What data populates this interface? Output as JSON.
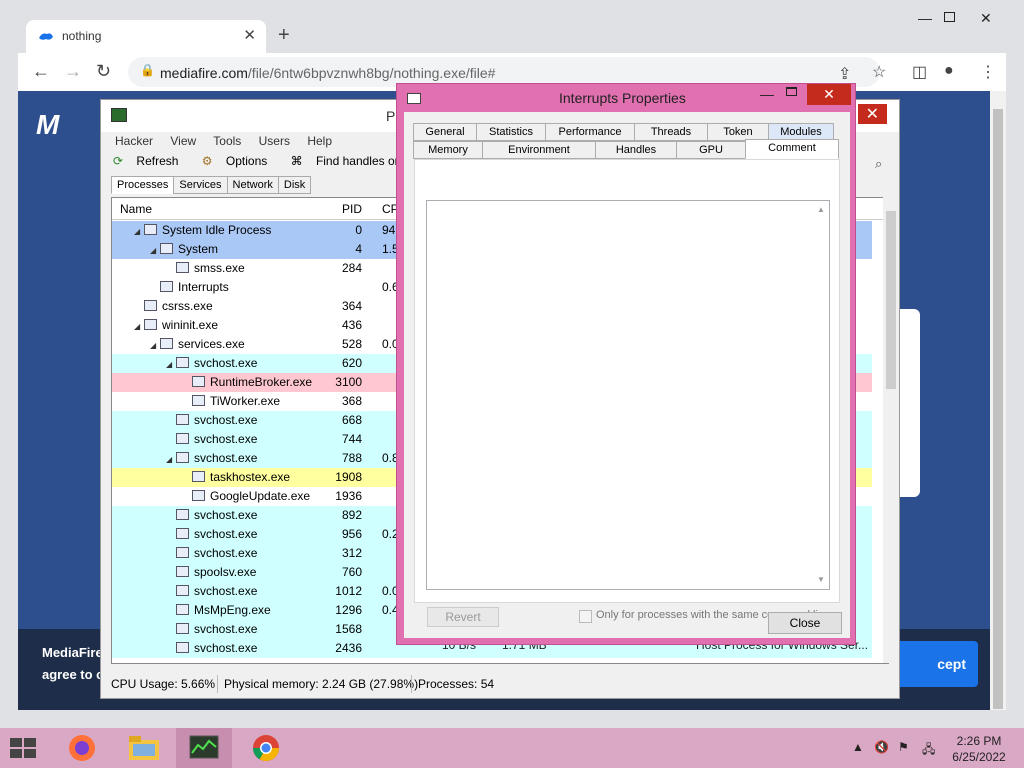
{
  "browser": {
    "tab_title": "nothing",
    "url_domain": "mediafire.com",
    "url_path": "/file/6ntw6bpvznwh8bg/nothing.exe/file#",
    "page": {
      "logo_text": "M",
      "cookie_text1": "MediaFire",
      "cookie_text2": "agree to c",
      "accept_label": "cept"
    }
  },
  "ph": {
    "title": "Pr",
    "menu": [
      "Hacker",
      "View",
      "Tools",
      "Users",
      "Help"
    ],
    "toolbar": {
      "refresh": "Refresh",
      "options": "Options",
      "find": "Find handles or DLLs"
    },
    "tabs": [
      "Processes",
      "Services",
      "Network",
      "Disk"
    ],
    "columns": {
      "name": "Name",
      "pid": "PID",
      "cpu": "CP"
    },
    "processes": [
      {
        "name": "System Idle Process",
        "pid": "0",
        "cpu": "94.3"
      },
      {
        "name": "System",
        "pid": "4",
        "cpu": "1.5"
      },
      {
        "name": "smss.exe",
        "pid": "284",
        "cpu": ""
      },
      {
        "name": "Interrupts",
        "pid": "",
        "cpu": "0.6"
      },
      {
        "name": "csrss.exe",
        "pid": "364",
        "cpu": ""
      },
      {
        "name": "wininit.exe",
        "pid": "436",
        "cpu": ""
      },
      {
        "name": "services.exe",
        "pid": "528",
        "cpu": "0.0"
      },
      {
        "name": "svchost.exe",
        "pid": "620",
        "cpu": ""
      },
      {
        "name": "RuntimeBroker.exe",
        "pid": "3100",
        "cpu": ""
      },
      {
        "name": "TiWorker.exe",
        "pid": "368",
        "cpu": ""
      },
      {
        "name": "svchost.exe",
        "pid": "668",
        "cpu": ""
      },
      {
        "name": "svchost.exe",
        "pid": "744",
        "cpu": ""
      },
      {
        "name": "svchost.exe",
        "pid": "788",
        "cpu": "0.8"
      },
      {
        "name": "taskhostex.exe",
        "pid": "1908",
        "cpu": ""
      },
      {
        "name": "GoogleUpdate.exe",
        "pid": "1936",
        "cpu": ""
      },
      {
        "name": "svchost.exe",
        "pid": "892",
        "cpu": ""
      },
      {
        "name": "svchost.exe",
        "pid": "956",
        "cpu": "0.2"
      },
      {
        "name": "svchost.exe",
        "pid": "312",
        "cpu": ""
      },
      {
        "name": "spoolsv.exe",
        "pid": "760",
        "cpu": ""
      },
      {
        "name": "svchost.exe",
        "pid": "1012",
        "cpu": "0.0"
      },
      {
        "name": "MsMpEng.exe",
        "pid": "1296",
        "cpu": "0.4"
      },
      {
        "name": "svchost.exe",
        "pid": "1568",
        "cpu": ""
      },
      {
        "name": "svchost.exe",
        "pid": "2436",
        "cpu": ""
      }
    ],
    "right_snippets": {
      "row22_a": "10 B/s",
      "row22_b": "1.71 MB",
      "row22_c": "Host Process for Windows Ser..."
    },
    "status": {
      "cpu": "CPU Usage: 5.66%",
      "mem": "Physical memory: 2.24 GB (27.98%)",
      "procs": "Processes: 54"
    }
  },
  "dialog": {
    "title": "Interrupts Properties",
    "tabs_row1": [
      "General",
      "Statistics",
      "Performance",
      "Threads",
      "Token",
      "Modules"
    ],
    "tabs_row2": [
      "Memory",
      "Environment",
      "Handles",
      "GPU",
      "Comment"
    ],
    "revert_label": "Revert",
    "checkbox_label": "Only for processes with the same command line",
    "close_label": "Close"
  },
  "taskbar": {
    "time": "2:26 PM",
    "date": "6/25/2022"
  }
}
